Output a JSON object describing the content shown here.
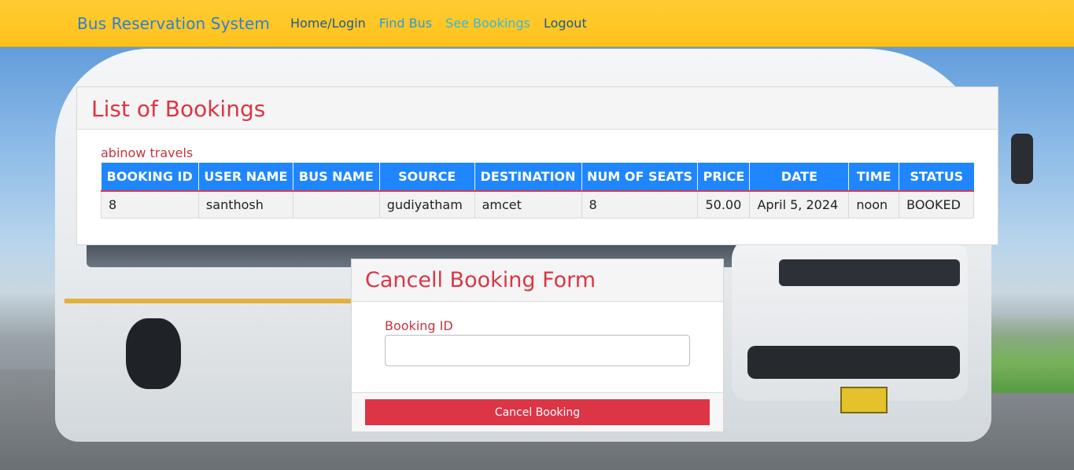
{
  "navbar": {
    "brand": "Bus Reservation System",
    "links": [
      {
        "label": "Home/Login"
      },
      {
        "label": "Find Bus"
      },
      {
        "label": "See Bookings"
      },
      {
        "label": "Logout"
      }
    ]
  },
  "bookings": {
    "title": "List of Bookings",
    "agency": "abinow travels",
    "columns": [
      "BOOKING ID",
      "USER NAME",
      "BUS NAME",
      "SOURCE",
      "DESTINATION",
      "NUM OF SEATS",
      "PRICE",
      "DATE",
      "TIME",
      "STATUS"
    ],
    "rows": [
      {
        "booking_id": "8",
        "user_name": "santhosh",
        "bus_name": "",
        "source": "gudiyatham",
        "destination": "amcet",
        "num_seats": "8",
        "price": "50.00",
        "date": "April 5, 2024",
        "time": "noon",
        "status": "BOOKED"
      }
    ]
  },
  "cancel_form": {
    "title": "Cancell Booking Form",
    "booking_id_label": "Booking ID",
    "booking_id_value": "",
    "submit_label": "Cancel Booking"
  },
  "colors": {
    "navbar": "#ffc21a",
    "brand": "#2e7fd1",
    "accent_red": "#dc3545",
    "table_header": "#1f86ff"
  }
}
